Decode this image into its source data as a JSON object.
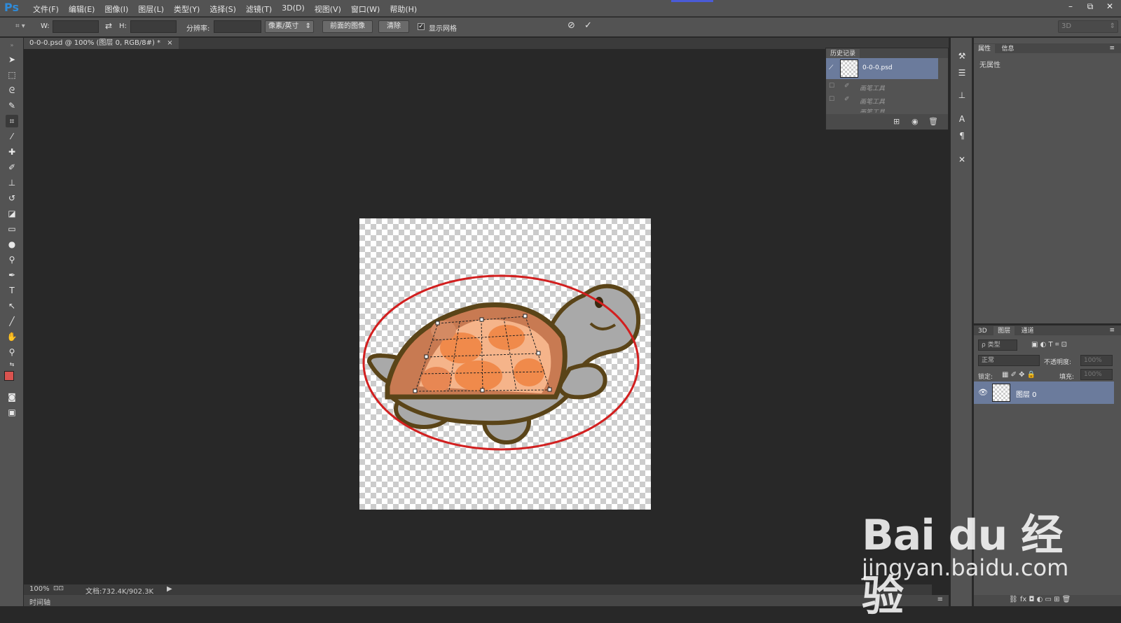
{
  "app": {
    "logo": "Ps"
  },
  "menu": [
    "文件(F)",
    "编辑(E)",
    "图像(I)",
    "图层(L)",
    "类型(Y)",
    "选择(S)",
    "滤镜(T)",
    "3D(D)",
    "视图(V)",
    "窗口(W)",
    "帮助(H)"
  ],
  "window_controls": {
    "minimize": "–",
    "restore": "⧉",
    "close": "✕"
  },
  "options": {
    "w_label": "W:",
    "h_label": "H:",
    "resolution_label": "分辨率:",
    "unit_select": "像素/英寸",
    "front_image_btn": "前面的图像",
    "clear_btn": "清除",
    "show_grid_label": "显示网格",
    "workspace": "3D"
  },
  "document": {
    "tab_title": "0-0-0.psd @ 100% (图层 0, RGB/8#) *",
    "tab_close": "×"
  },
  "statusbar": {
    "zoom": "100%",
    "doc_info": "文档:732.4K/902.3K"
  },
  "timeline": {
    "label": "时间轴"
  },
  "history": {
    "tab": "历史记录",
    "snapshot": "0-0-0.psd",
    "items": [
      "画笔工具",
      "画笔工具",
      "画笔工具"
    ]
  },
  "properties": {
    "tabs": [
      "属性",
      "信息"
    ],
    "empty": "无属性"
  },
  "layers": {
    "tabs": [
      "3D",
      "图层",
      "通道"
    ],
    "filter_kind": "ρ 类型",
    "blend_mode": "正常",
    "opacity_label": "不透明度:",
    "opacity_value": "100%",
    "lock_label": "锁定:",
    "fill_label": "填充:",
    "fill_value": "100%",
    "layer_name": "图层 0"
  },
  "watermark": {
    "brand": "Bai du 经验",
    "url": "jingyan.baidu.com"
  },
  "colors": {
    "accent_blue": "#6b7b9c",
    "foreground_swatch": "#d9534f",
    "background_swatch": "#f2a86a",
    "ellipse": "#d21f1f",
    "turtle_outline": "#5a4418",
    "turtle_body": "#a9a9a9",
    "shell_orange": "#f08a4b"
  }
}
